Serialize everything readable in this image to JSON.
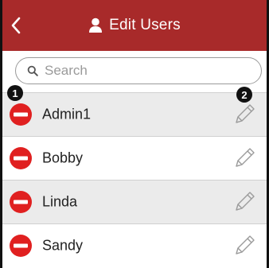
{
  "header": {
    "title": "Edit Users",
    "background": "#a82a2a",
    "back_icon": "chevron-left-icon",
    "user_icon": "user-icon"
  },
  "search": {
    "placeholder": "Search",
    "value": ""
  },
  "users": [
    {
      "name": "Admin1"
    },
    {
      "name": "Bobby"
    },
    {
      "name": "Linda"
    },
    {
      "name": "Sandy"
    }
  ],
  "callouts": {
    "one": "1",
    "two": "2"
  },
  "colors": {
    "delete": "#e02020",
    "row_alt": "#ebebeb",
    "pencil": "#9b9b9b"
  }
}
